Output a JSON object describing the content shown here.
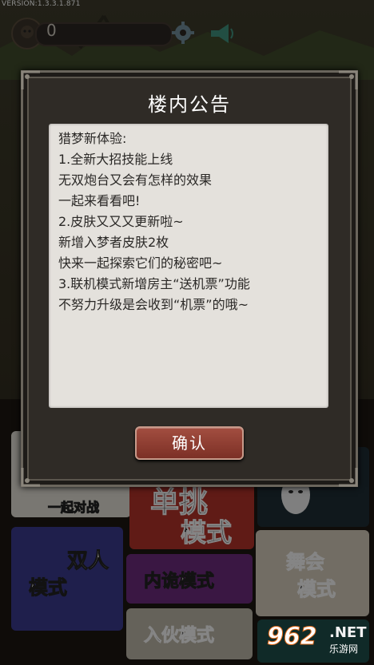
{
  "version": "VERSION:1.3.3.1.871",
  "topbar": {
    "coin_count": "0",
    "icons": [
      "avatar-icon",
      "gear-icon",
      "horn-icon"
    ]
  },
  "menu": {
    "invite_sub": "一起对战",
    "single_title": "单挑",
    "single_sub": "模式",
    "double_title": "双人",
    "double_sub": "模式",
    "dance_title": "舞会",
    "dance_sub": "模式",
    "mole_label": "内诡模式",
    "party_label": "入伙模式"
  },
  "dialog": {
    "title": "楼内公告",
    "lines": [
      "猎梦新体验:",
      "1.全新大招技能上线",
      "无双炮台又会有怎样的效果",
      "一起来看看吧!",
      "2.皮肤又又又更新啦~",
      "新增入梦者皮肤2枚",
      "快来一起探索它们的秘密吧~",
      "3.联机模式新增房主“送机票”功能",
      "不努力升级是会收到“机票”的哦~"
    ],
    "confirm_label": "确认"
  },
  "watermark": {
    "number": "962",
    "net": ".NET",
    "sub": "乐游网"
  },
  "colors": {
    "dialog_bg": "#2f2b26",
    "paper": "#e4e1dc",
    "button": "#8c3a2e"
  }
}
